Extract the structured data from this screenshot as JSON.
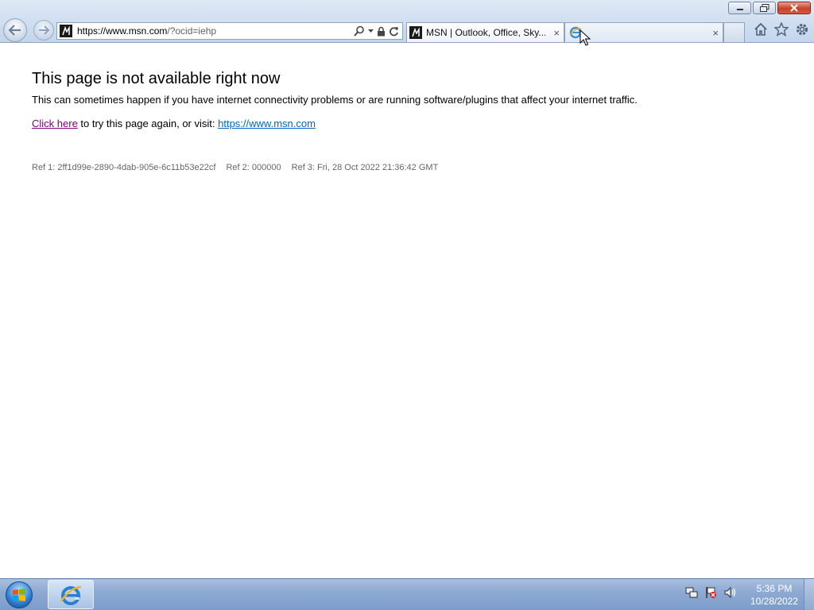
{
  "browser": {
    "address": {
      "url_prefix": "https://www.",
      "url_host": "msn.com",
      "url_rest": "/?ocid=iehp"
    },
    "tabs": [
      {
        "title": "MSN | Outlook, Office, Sky...",
        "close": "×"
      },
      {
        "title": "",
        "close": "×"
      }
    ]
  },
  "page": {
    "heading": "This page is not available right now",
    "description": "This can sometimes happen if you have internet connectivity problems or are running software/plugins that affect your internet traffic.",
    "retry_link": "Click here",
    "retry_text": " to try this page again, or visit: ",
    "msn_link": "https://www.msn.com",
    "ref1": "Ref 1: 2ff1d99e-2890-4dab-905e-6c11b53e22cf",
    "ref2": "Ref 2: 000000",
    "ref3": "Ref 3: Fri, 28 Oct 2022 21:36:42 GMT"
  },
  "taskbar": {
    "time": "5:36 PM",
    "date": "10/28/2022"
  },
  "colors": {
    "visited_link": "#800080",
    "link": "#0066cc",
    "close_button": "#c7412a"
  },
  "icons": {
    "back": "back-arrow-icon",
    "forward": "forward-arrow-icon",
    "search": "search-icon",
    "lock": "lock-icon",
    "refresh": "refresh-icon",
    "home": "home-icon",
    "favorites": "star-icon",
    "tools": "gear-icon"
  }
}
